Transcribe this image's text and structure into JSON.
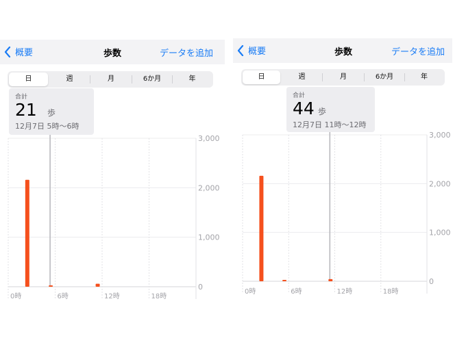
{
  "panels": [
    {
      "nav": {
        "back_label": "概要",
        "title": "歩数",
        "add_label": "データを追加"
      },
      "segments": [
        "日",
        "週",
        "月",
        "6か月",
        "年"
      ],
      "selected_segment": "日",
      "summary": {
        "label": "合計",
        "value": "21",
        "unit": "歩",
        "range": "12月7日 5時〜6時"
      },
      "chart_data": {
        "type": "bar",
        "x_tick_labels": [
          "0時",
          "6時",
          "12時",
          "18時"
        ],
        "y_tick_labels": [
          "3,000",
          "2,000",
          "1,000",
          "0"
        ],
        "ylim": [
          0,
          3000
        ],
        "xlim": [
          0,
          24
        ],
        "hours": [
          2,
          5,
          11
        ],
        "values": [
          2160,
          21,
          60
        ],
        "selected_hour": 5,
        "bar_color": "#f5501d"
      }
    },
    {
      "nav": {
        "back_label": "概要",
        "title": "歩数",
        "add_label": "データを追加"
      },
      "segments": [
        "日",
        "週",
        "月",
        "6か月",
        "年"
      ],
      "selected_segment": "日",
      "summary": {
        "label": "合計",
        "value": "44",
        "unit": "歩",
        "range": "12月7日 11時〜12時"
      },
      "chart_data": {
        "type": "bar",
        "x_tick_labels": [
          "0時",
          "6時",
          "12時",
          "18時"
        ],
        "y_tick_labels": [
          "3,000",
          "2,000",
          "1,000",
          "0"
        ],
        "ylim": [
          0,
          3000
        ],
        "xlim": [
          0,
          24
        ],
        "hours": [
          2,
          5,
          11
        ],
        "values": [
          2160,
          21,
          44
        ],
        "selected_hour": 11,
        "bar_color": "#f5501d"
      }
    }
  ],
  "colors": {
    "accent": "#1a7cf5",
    "bar": "#f5501d"
  }
}
